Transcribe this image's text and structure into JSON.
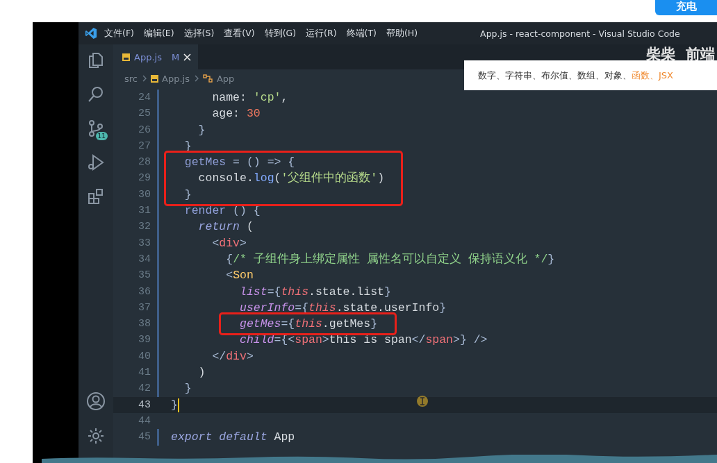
{
  "top_button": {
    "label": "充电"
  },
  "window": {
    "title": "App.js - react-component - Visual Studio Code"
  },
  "menu": [
    "文件(F)",
    "编辑(E)",
    "选择(S)",
    "查看(V)",
    "转到(G)",
    "运行(R)",
    "终端(T)",
    "帮助(H)"
  ],
  "activity_bar": {
    "top": [
      {
        "kind": "files"
      },
      {
        "kind": "search"
      },
      {
        "kind": "source-control",
        "badge": "11"
      },
      {
        "kind": "run"
      },
      {
        "kind": "extensions"
      }
    ],
    "bottom": [
      {
        "kind": "account"
      },
      {
        "kind": "settings"
      }
    ]
  },
  "tabs": [
    {
      "label": "App.js",
      "status": "M",
      "selected": true
    }
  ],
  "breadcrumb": [
    {
      "kind": "folder",
      "label": "src"
    },
    {
      "kind": "file",
      "label": "App.js"
    },
    {
      "kind": "class",
      "label": "App"
    }
  ],
  "channel_logo": "柴柴  前端",
  "caption": {
    "plain": "数字、字符串、布尔值、数组、对象、",
    "accent": "函数、JSX"
  },
  "code_lines": [
    {
      "number": "24",
      "modified": true,
      "boxed": false,
      "current": false,
      "tokens": [
        {
          "kind": "plain",
          "text": "      name: "
        },
        {
          "kind": "string",
          "text": "'cp'"
        },
        {
          "kind": "plain",
          "text": ","
        }
      ]
    },
    {
      "number": "25",
      "modified": true,
      "boxed": false,
      "current": false,
      "tokens": [
        {
          "kind": "plain",
          "text": "      age: "
        },
        {
          "kind": "number",
          "text": "30"
        }
      ]
    },
    {
      "number": "26",
      "modified": true,
      "boxed": false,
      "current": false,
      "tokens": [
        {
          "kind": "brace",
          "text": "    }"
        }
      ]
    },
    {
      "number": "27",
      "modified": true,
      "boxed": false,
      "current": false,
      "tokens": [
        {
          "kind": "brace",
          "text": "  }"
        }
      ]
    },
    {
      "number": "28",
      "modified": true,
      "boxed": true,
      "current": false,
      "tokens": [
        {
          "kind": "function",
          "text": "  getMes"
        },
        {
          "kind": "brace",
          "text": " = () => {"
        }
      ]
    },
    {
      "number": "29",
      "modified": true,
      "boxed": true,
      "current": false,
      "tokens": [
        {
          "kind": "plain",
          "text": "    console."
        },
        {
          "kind": "method",
          "text": "log"
        },
        {
          "kind": "plain",
          "text": "("
        },
        {
          "kind": "string",
          "text": "'父组件中的函数'"
        },
        {
          "kind": "plain",
          "text": ")"
        }
      ]
    },
    {
      "number": "30",
      "modified": true,
      "boxed": true,
      "current": false,
      "tokens": [
        {
          "kind": "brace",
          "text": "  }"
        }
      ]
    },
    {
      "number": "31",
      "modified": true,
      "boxed": false,
      "current": false,
      "tokens": [
        {
          "kind": "function",
          "text": "  render"
        },
        {
          "kind": "brace",
          "text": " () {"
        }
      ]
    },
    {
      "number": "32",
      "modified": true,
      "boxed": false,
      "current": false,
      "tokens": [
        {
          "kind": "keyword",
          "text": "    return"
        },
        {
          "kind": "plain",
          "text": " ("
        }
      ]
    },
    {
      "number": "33",
      "modified": true,
      "boxed": false,
      "current": false,
      "tokens": [
        {
          "kind": "brace",
          "text": "      <"
        },
        {
          "kind": "tag",
          "text": "div"
        },
        {
          "kind": "brace",
          "text": ">"
        }
      ]
    },
    {
      "number": "34",
      "modified": true,
      "boxed": false,
      "current": false,
      "tokens": [
        {
          "kind": "brace",
          "text": "        {"
        },
        {
          "kind": "comment",
          "text": "/* 子组件身上绑定属性 属性名可以自定义 保持语义化 */"
        },
        {
          "kind": "brace",
          "text": "}"
        }
      ]
    },
    {
      "number": "35",
      "modified": true,
      "boxed": false,
      "current": false,
      "tokens": [
        {
          "kind": "brace",
          "text": "        <"
        },
        {
          "kind": "component",
          "text": "Son"
        }
      ]
    },
    {
      "number": "36",
      "modified": true,
      "boxed": false,
      "current": false,
      "tokens": [
        {
          "kind": "attribute",
          "text": "          list"
        },
        {
          "kind": "brace",
          "text": "={"
        },
        {
          "kind": "this",
          "text": "this"
        },
        {
          "kind": "plain",
          "text": ".state.list"
        },
        {
          "kind": "brace",
          "text": "}"
        }
      ]
    },
    {
      "number": "37",
      "modified": true,
      "boxed": false,
      "current": false,
      "tokens": [
        {
          "kind": "attribute",
          "text": "          userInfo"
        },
        {
          "kind": "brace",
          "text": "={"
        },
        {
          "kind": "this",
          "text": "this"
        },
        {
          "kind": "plain",
          "text": ".state.userInfo"
        },
        {
          "kind": "brace",
          "text": "}"
        }
      ]
    },
    {
      "number": "38",
      "modified": true,
      "boxed": true,
      "current": false,
      "tokens": [
        {
          "kind": "attribute",
          "text": "          getMes"
        },
        {
          "kind": "brace",
          "text": "={"
        },
        {
          "kind": "this",
          "text": "this"
        },
        {
          "kind": "plain",
          "text": ".getMes"
        },
        {
          "kind": "brace",
          "text": "}"
        }
      ]
    },
    {
      "number": "39",
      "modified": true,
      "boxed": false,
      "current": false,
      "tokens": [
        {
          "kind": "attribute",
          "text": "          child"
        },
        {
          "kind": "brace",
          "text": "={<"
        },
        {
          "kind": "tag",
          "text": "span"
        },
        {
          "kind": "brace",
          "text": ">"
        },
        {
          "kind": "plain",
          "text": "this is span"
        },
        {
          "kind": "brace",
          "text": "</"
        },
        {
          "kind": "tag",
          "text": "span"
        },
        {
          "kind": "brace",
          "text": ">} />"
        }
      ]
    },
    {
      "number": "40",
      "modified": true,
      "boxed": false,
      "current": false,
      "tokens": [
        {
          "kind": "brace",
          "text": "      </"
        },
        {
          "kind": "tag",
          "text": "div"
        },
        {
          "kind": "brace",
          "text": ">"
        }
      ]
    },
    {
      "number": "41",
      "modified": true,
      "boxed": false,
      "current": false,
      "tokens": [
        {
          "kind": "plain",
          "text": "    )"
        }
      ]
    },
    {
      "number": "42",
      "modified": true,
      "boxed": false,
      "current": false,
      "tokens": [
        {
          "kind": "brace",
          "text": "  }"
        }
      ]
    },
    {
      "number": "43",
      "modified": false,
      "boxed": false,
      "current": true,
      "tokens": [
        {
          "kind": "brace",
          "text": "}"
        }
      ]
    },
    {
      "number": "44",
      "modified": false,
      "boxed": false,
      "current": false
    },
    {
      "number": "45",
      "modified": true,
      "boxed": false,
      "current": false,
      "tokens": [
        {
          "kind": "keyword",
          "text": "export default"
        },
        {
          "kind": "plain",
          "text": " App"
        }
      ]
    }
  ]
}
